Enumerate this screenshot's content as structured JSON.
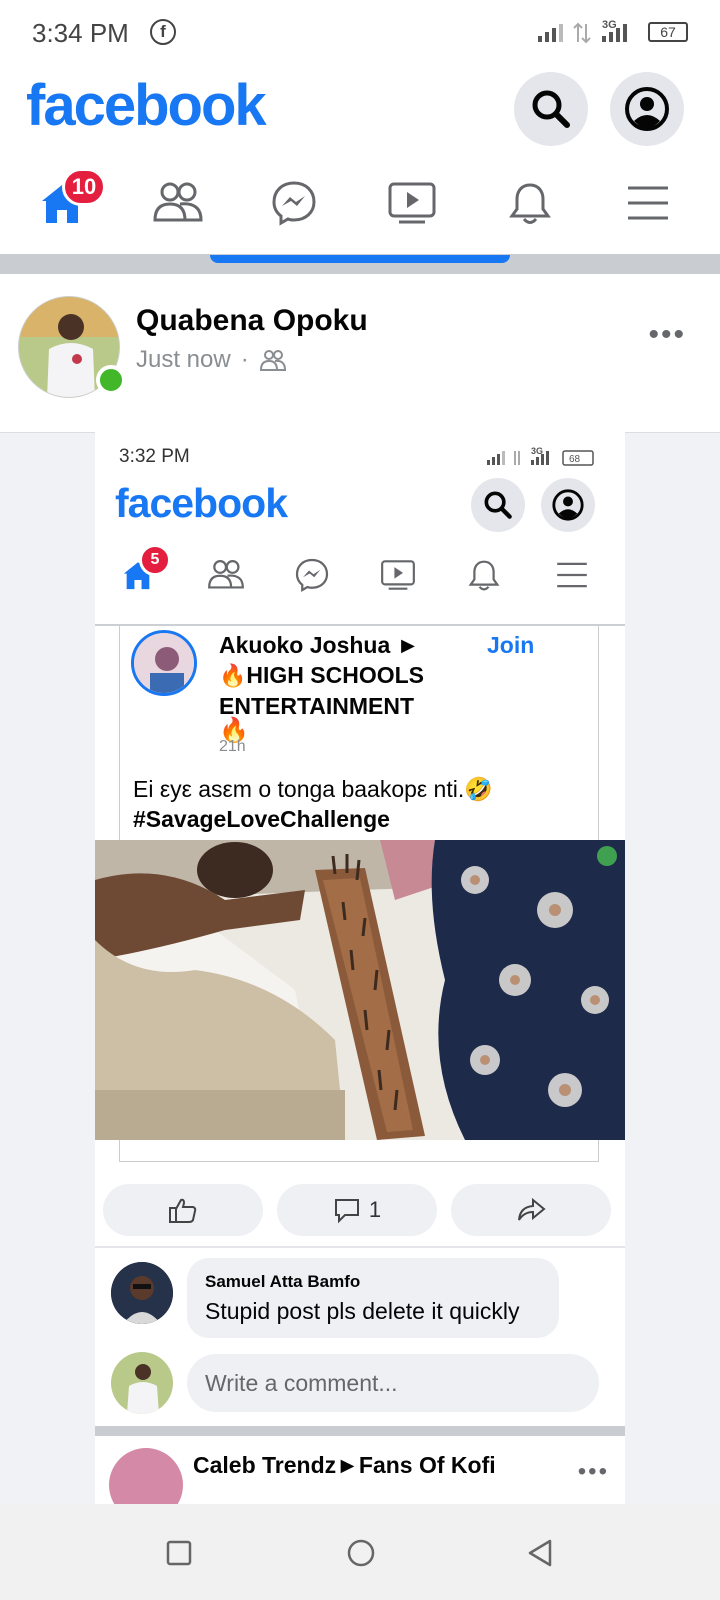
{
  "status_bar": {
    "time": "3:34 PM",
    "app_icon": "facebook-notification-icon",
    "network": "3G",
    "battery": "67"
  },
  "header": {
    "logo": "facebook",
    "search_icon": "search-icon",
    "profile_icon": "profile-icon"
  },
  "nav": {
    "home_badge": "10",
    "items": [
      "home-icon",
      "friends-icon",
      "messenger-icon",
      "watch-icon",
      "notifications-icon",
      "menu-icon"
    ]
  },
  "post": {
    "author": "Quabena Opoku",
    "time": "Just now",
    "separator": "·",
    "audience_icon": "friends-audience-icon",
    "more": "•••"
  },
  "screenshot": {
    "status_time": "3:32 PM",
    "network": "3G",
    "battery": "68",
    "logo": "facebook",
    "home_badge": "5",
    "shared_post": {
      "author_line1": "Akuoko Joshua ►",
      "author_line2": "HIGH SCHOOLS",
      "author_line3": "ENTERTAINMENT",
      "join": "Join",
      "time": "21h",
      "text": "Ei εyε asεm o tonga baakopε nti.🤣",
      "hashtag": "#SavageLoveChallenge"
    },
    "actions": {
      "comment_count": "1"
    },
    "comment": {
      "name": "Samuel Atta Bamfo",
      "text": "Stupid post pls delete it quickly"
    },
    "write_placeholder": "Write a comment...",
    "next_post": {
      "title": "Caleb Trendz►Fans Of Kofi",
      "more": "•••"
    }
  },
  "colors": {
    "brand": "#1877f2",
    "badge": "#e41e3f",
    "online": "#42b72a"
  }
}
